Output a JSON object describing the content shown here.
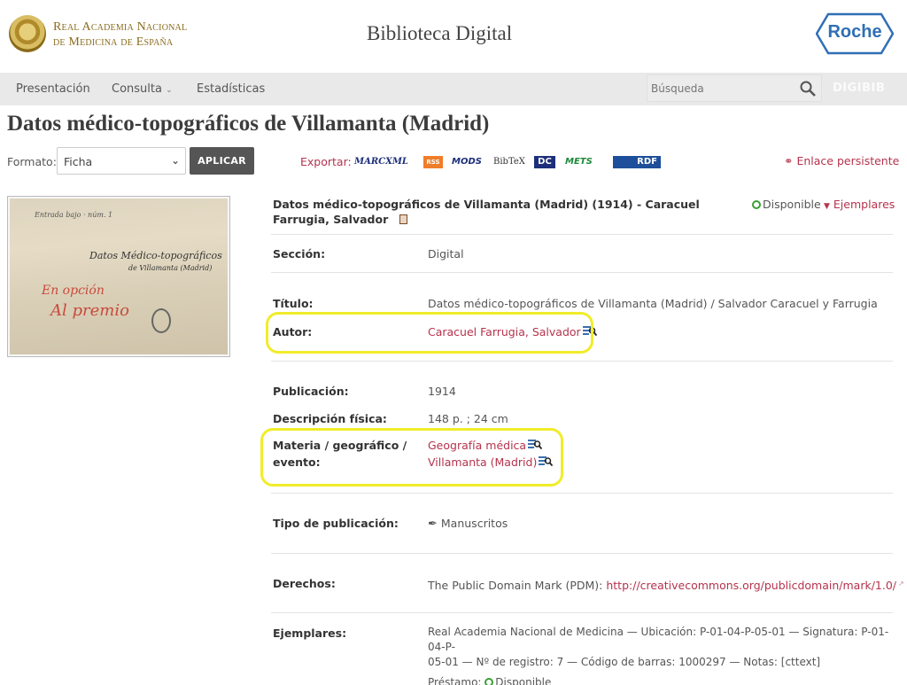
{
  "header": {
    "academy_line1": "Real Academia Nacional",
    "academy_line2": "de Medicina de España",
    "site_title": "Biblioteca Digital",
    "sponsor_logo": "Roche"
  },
  "nav": {
    "items": [
      "Presentación",
      "Consulta",
      "Estadísticas"
    ],
    "search_placeholder": "Búsqueda",
    "brand": "DIGIBIB"
  },
  "page": {
    "title": "Datos médico-topográficos de Villamanta (Madrid)"
  },
  "format_bar": {
    "label": "Formato:",
    "selected": "Ficha",
    "apply_label": "APLICAR",
    "export_label": "Exportar:",
    "export_formats": [
      "MARCXML",
      "RSS",
      "MODS",
      "BibTeX",
      "DC",
      "METS",
      "RDF"
    ],
    "persistent_link": "Enlace persistente"
  },
  "thumbnail": {
    "lines": [
      "Datos Médico-topográficos",
      "de Villamanta (Madrid)",
      "En opción",
      "Al premio"
    ]
  },
  "record": {
    "heading": "Datos médico-topográficos de Villamanta (Madrid) (1914) - Caracuel Farrugia, Salvador",
    "status": "Disponible",
    "copies_link": "Ejemplares",
    "seccion_label": "Sección:",
    "seccion": "Digital",
    "titulo_label": "Título:",
    "titulo": "Datos médico-topográficos de Villamanta (Madrid) / Salvador Caracuel y Farrugia",
    "autor_label": "Autor:",
    "autor": "Caracuel Farrugia, Salvador",
    "publicacion_label": "Publicación:",
    "publicacion": "1914",
    "descripcion_label": "Descripción física:",
    "descripcion": "148 p. ; 24 cm",
    "materia_label_1": "Materia / geográfico /",
    "materia_label_2": "evento:",
    "materia_1": "Geografía médica",
    "materia_2": "Villamanta (Madrid)",
    "tipo_label": "Tipo de publicación:",
    "tipo": "Manuscritos",
    "derechos_label": "Derechos:",
    "derechos_prefix": "The Public Domain Mark (PDM): ",
    "derechos_link": "http://creativecommons.org/publicdomain/mark/1.0/",
    "ejemplares_label": "Ejemplares:",
    "ejemplares_line1": "Real Academia Nacional de Medicina — Ubicación: P-01-04-P-05-01 — Signatura: P-01-04-P-",
    "ejemplares_line2": "05-01 — Nº de registro: 7 — Código de barras: 1000297 — Notas: [cttext]",
    "prestamo_label": "Préstamo:",
    "prestamo_status": "Disponible"
  },
  "colors": {
    "accent": "#b5334d",
    "highlight": "#f1ec2a",
    "status_green": "#3aa035",
    "roche_blue": "#2f6fb5"
  }
}
